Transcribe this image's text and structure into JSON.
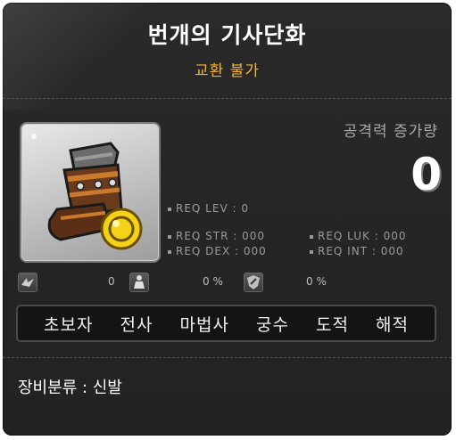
{
  "item": {
    "name": "번개의 기사단화",
    "trade_status": "교환 불가",
    "attack_increase_label": "공격력 증가량",
    "attack_increase_value": "0"
  },
  "requirements": {
    "level": "REQ LEV :    0",
    "str": "REQ STR : 000",
    "luk": "REQ LUK : 000",
    "dex": "REQ DEX : 000",
    "int": "REQ INT : 000"
  },
  "stat_icons": [
    {
      "icon": "wing-emblem-icon",
      "value": "0"
    },
    {
      "icon": "character-figure-icon",
      "value": "0 %"
    },
    {
      "icon": "shield-icon",
      "value": "0 %"
    }
  ],
  "jobs": [
    "초보자",
    "전사",
    "마법사",
    "궁수",
    "도적",
    "해적"
  ],
  "equipment_category": "장비분류 : 신발",
  "colors": {
    "background": "#262626",
    "title": "#ffffff",
    "trade_status": "#f2b33d",
    "muted_text": "#9a9a9a"
  }
}
